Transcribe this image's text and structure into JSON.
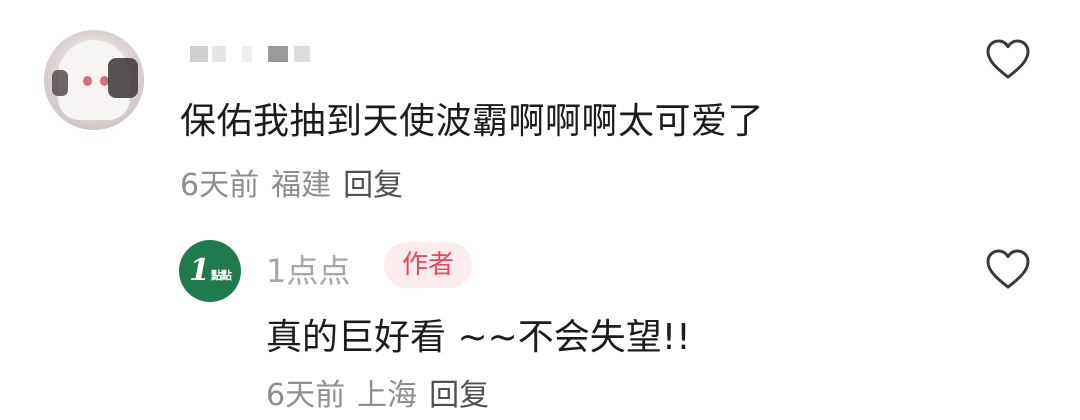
{
  "comments": [
    {
      "username_redacted": true,
      "text": "保佑我抽到天使波霸啊啊啊太可爱了",
      "time": "6天前",
      "location": "福建",
      "reply_label": "回复",
      "avatar_icon": "anime-girl-avatar",
      "like_icon": "heart-outline-icon"
    },
    {
      "username": "1点点",
      "badge": "作者",
      "text": "真的巨好看 ~~不会失望!!",
      "time": "6天前",
      "location": "上海",
      "reply_label": "回复",
      "avatar": {
        "logo_main": "1",
        "logo_sub": "點點",
        "color": "#1f7a4d"
      },
      "like_icon": "heart-outline-icon"
    }
  ],
  "colors": {
    "meta_text": "#8e8e8e",
    "badge_text": "#e8485a",
    "badge_bg": "#fdecee",
    "brand_green": "#1f7a4d"
  }
}
